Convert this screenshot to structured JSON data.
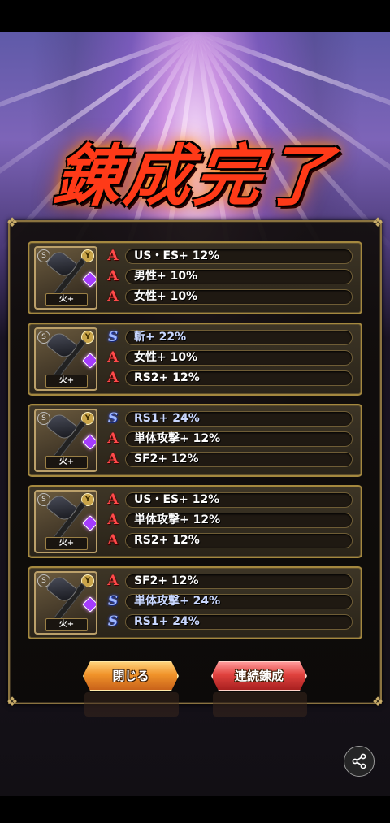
{
  "title": "錬成完了",
  "cards": [
    {
      "element": "火+",
      "effects": [
        {
          "rank": "A",
          "text": "US・ES+ 12%"
        },
        {
          "rank": "A",
          "text": "男性+ 10%"
        },
        {
          "rank": "A",
          "text": "女性+ 10%"
        }
      ]
    },
    {
      "element": "火+",
      "effects": [
        {
          "rank": "S",
          "text": "斬+ 22%"
        },
        {
          "rank": "A",
          "text": "女性+ 10%"
        },
        {
          "rank": "A",
          "text": "RS2+ 12%"
        }
      ]
    },
    {
      "element": "火+",
      "effects": [
        {
          "rank": "S",
          "text": "RS1+ 24%"
        },
        {
          "rank": "A",
          "text": "単体攻撃+ 12%"
        },
        {
          "rank": "A",
          "text": "SF2+ 12%"
        }
      ]
    },
    {
      "element": "火+",
      "effects": [
        {
          "rank": "A",
          "text": "US・ES+ 12%"
        },
        {
          "rank": "A",
          "text": "単体攻撃+ 12%"
        },
        {
          "rank": "A",
          "text": "RS2+ 12%"
        }
      ]
    },
    {
      "element": "火+",
      "effects": [
        {
          "rank": "A",
          "text": "SF2+ 12%"
        },
        {
          "rank": "S",
          "text": "単体攻撃+ 24%"
        },
        {
          "rank": "S",
          "text": "RS1+ 24%"
        }
      ]
    }
  ],
  "buttons": {
    "close": "閉じる",
    "continuous": "連続錬成"
  },
  "icons": {
    "share": "share-icon",
    "weapon": "axe-icon",
    "gem": "gem-icon"
  },
  "colors": {
    "rank_a": "#ff4a4a",
    "rank_s": "#9fb8ff",
    "close_button": "#f0932a",
    "continuous_button": "#e0423e",
    "frame_gold": "#a4883f"
  }
}
